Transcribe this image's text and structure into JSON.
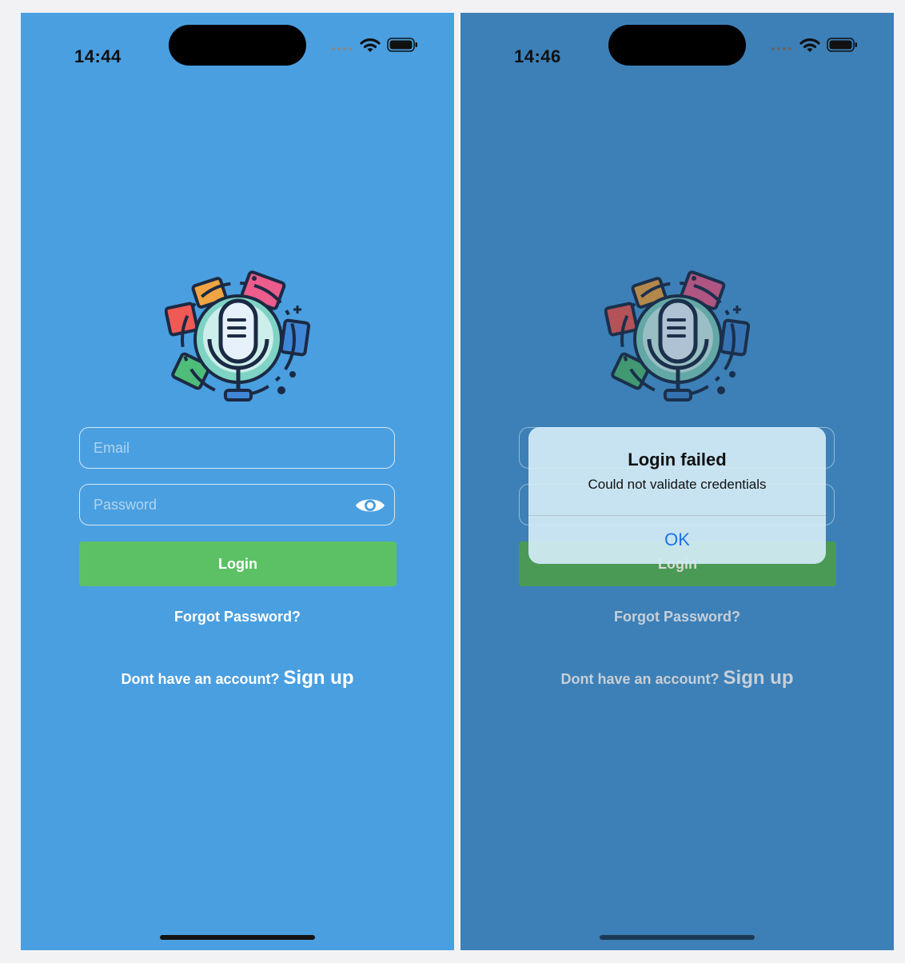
{
  "screens": {
    "left": {
      "status_time": "14:44",
      "email_placeholder": "Email",
      "password_placeholder": "Password",
      "login_label": "Login",
      "forgot_label": "Forgot Password?",
      "signup_prompt": "Dont have an account?",
      "signup_label": "Sign up"
    },
    "right": {
      "status_time": "14:46",
      "login_label": "Login",
      "forgot_label": "Forgot Password?",
      "signup_prompt": "Dont have an account?",
      "signup_label": "Sign up",
      "alert": {
        "title": "Login failed",
        "message": "Could not validate credentials",
        "ok_label": "OK"
      }
    }
  },
  "colors": {
    "background": "#4a9fe0",
    "background_dimmed": "#3c80b7",
    "login_button": "#5cc165",
    "alert_action": "#1a73e8"
  },
  "icons": [
    "podcast-microphone-logo",
    "eye-icon",
    "wifi-icon",
    "battery-icon",
    "signal-dots-icon"
  ]
}
